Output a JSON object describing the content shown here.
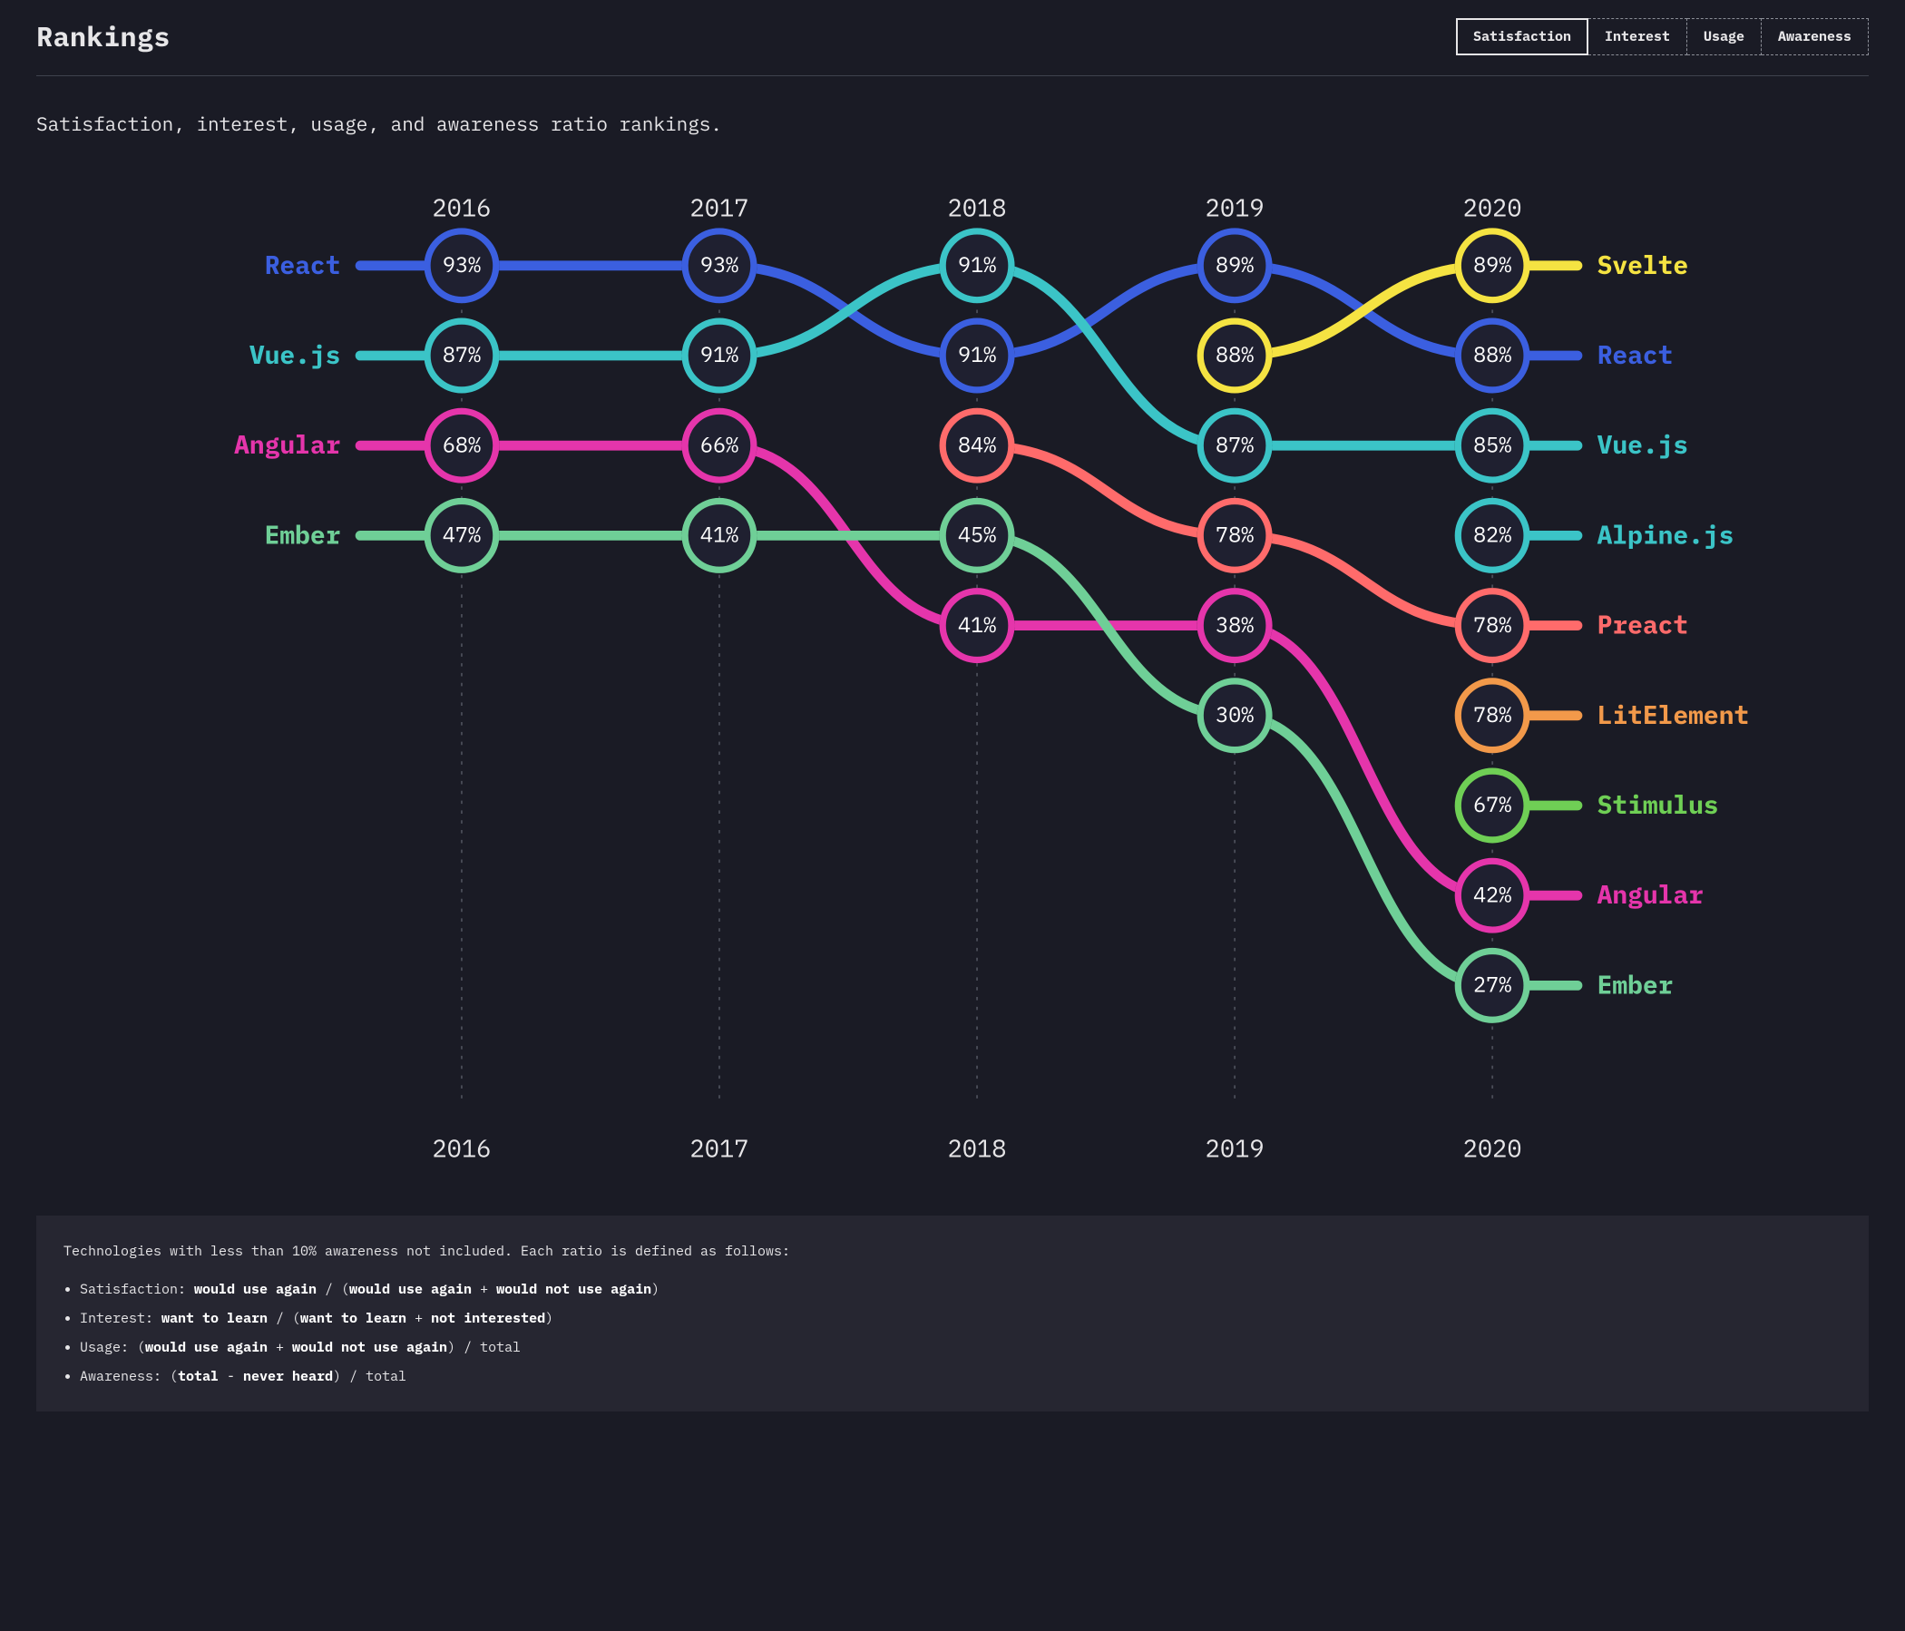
{
  "title": "Rankings",
  "tabs": [
    "Satisfaction",
    "Interest",
    "Usage",
    "Awareness"
  ],
  "active_tab": 0,
  "subtitle": "Satisfaction, interest, usage, and awareness ratio rankings.",
  "note_intro": "Technologies with less than 10% awareness not included. Each ratio is defined as follows:",
  "definitions": [
    {
      "term": "Satisfaction",
      "formula_html": "<b>would use again</b> / (<b>would use again</b> + <b>would not use again</b>)"
    },
    {
      "term": "Interest",
      "formula_html": "<b>want to learn</b> / (<b>want to learn</b> + <b>not interested</b>)"
    },
    {
      "term": "Usage",
      "formula_html": "(<b>would use again</b> + <b>would not use again</b>) / total"
    },
    {
      "term": "Awareness",
      "formula_html": "(<b>total</b> - <b>never heard</b>) / total"
    }
  ],
  "colors": {
    "React": "#3b5fe0",
    "Vue.js": "#3bc4c7",
    "Angular": "#e535ab",
    "Ember": "#6fcf97",
    "Svelte": "#f5e342",
    "Preact": "#ff6b6b",
    "Alpine.js": "#3bc4c7",
    "LitElement": "#f2994a",
    "Stimulus": "#6fcf55"
  },
  "chart_data": {
    "type": "bump",
    "title": "Rankings — Satisfaction",
    "years": [
      "2016",
      "2017",
      "2018",
      "2019",
      "2020"
    ],
    "max_rank": 9,
    "series": [
      {
        "name": "React",
        "ranks": [
          1,
          1,
          2,
          1,
          2
        ],
        "values": [
          93,
          93,
          91,
          89,
          88
        ]
      },
      {
        "name": "Vue.js",
        "ranks": [
          2,
          2,
          1,
          3,
          3
        ],
        "values": [
          87,
          91,
          91,
          87,
          85
        ]
      },
      {
        "name": "Angular",
        "ranks": [
          3,
          3,
          5,
          5,
          8
        ],
        "values": [
          68,
          66,
          41,
          38,
          42
        ]
      },
      {
        "name": "Ember",
        "ranks": [
          4,
          4,
          4,
          6,
          9
        ],
        "values": [
          47,
          41,
          45,
          30,
          27
        ]
      },
      {
        "name": "Svelte",
        "ranks": [
          null,
          null,
          null,
          2,
          1
        ],
        "values": [
          null,
          null,
          null,
          88,
          89
        ]
      },
      {
        "name": "Preact",
        "ranks": [
          null,
          null,
          3,
          4,
          5
        ],
        "values": [
          null,
          null,
          84,
          78,
          78
        ]
      },
      {
        "name": "Alpine.js",
        "ranks": [
          null,
          null,
          null,
          null,
          4
        ],
        "values": [
          null,
          null,
          null,
          null,
          82
        ]
      },
      {
        "name": "LitElement",
        "ranks": [
          null,
          null,
          null,
          null,
          6
        ],
        "values": [
          null,
          null,
          null,
          null,
          78
        ]
      },
      {
        "name": "Stimulus",
        "ranks": [
          null,
          null,
          null,
          null,
          7
        ],
        "values": [
          null,
          null,
          null,
          null,
          67
        ]
      }
    ],
    "left_labels": [
      {
        "rank": 1,
        "name": "React"
      },
      {
        "rank": 2,
        "name": "Vue.js"
      },
      {
        "rank": 3,
        "name": "Angular"
      },
      {
        "rank": 4,
        "name": "Ember"
      }
    ],
    "right_labels": [
      {
        "rank": 1,
        "name": "Svelte"
      },
      {
        "rank": 2,
        "name": "React"
      },
      {
        "rank": 3,
        "name": "Vue.js"
      },
      {
        "rank": 4,
        "name": "Alpine.js"
      },
      {
        "rank": 5,
        "name": "Preact"
      },
      {
        "rank": 6,
        "name": "LitElement"
      },
      {
        "rank": 7,
        "name": "Stimulus"
      },
      {
        "rank": 8,
        "name": "Angular"
      },
      {
        "rank": 9,
        "name": "Ember"
      }
    ]
  }
}
